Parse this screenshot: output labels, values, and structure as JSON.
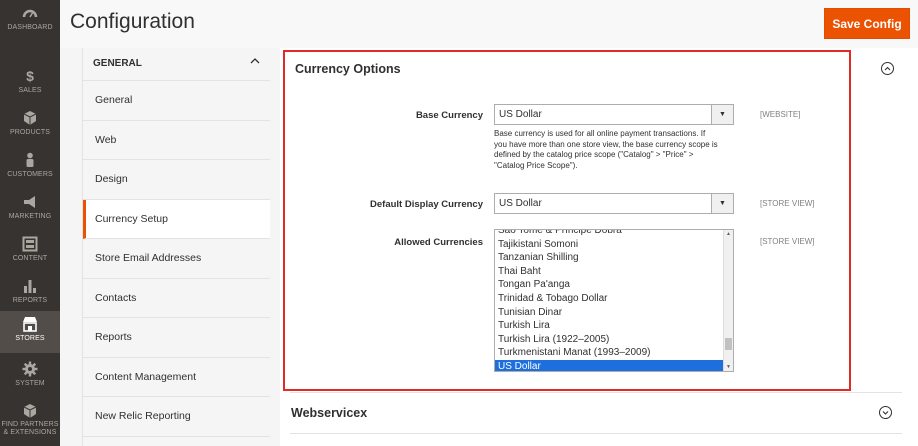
{
  "nav": [
    {
      "label": "DASHBOARD",
      "icon": "dashboard-icon"
    },
    {
      "label": "SALES",
      "icon": "dollar-icon"
    },
    {
      "label": "PRODUCTS",
      "icon": "cube-icon"
    },
    {
      "label": "CUSTOMERS",
      "icon": "person-icon"
    },
    {
      "label": "MARKETING",
      "icon": "megaphone-icon"
    },
    {
      "label": "CONTENT",
      "icon": "layout-icon"
    },
    {
      "label": "REPORTS",
      "icon": "bar-chart-icon"
    },
    {
      "label": "STORES",
      "icon": "store-icon"
    },
    {
      "label": "SYSTEM",
      "icon": "gear-icon"
    },
    {
      "label": "FIND PARTNERS",
      "label2": "& EXTENSIONS",
      "icon": "box-icon"
    }
  ],
  "header": {
    "title": "Configuration",
    "save_label": "Save Config"
  },
  "tabs": {
    "group_title": "GENERAL",
    "items": [
      "General",
      "Web",
      "Design",
      "Currency Setup",
      "Store Email Addresses",
      "Contacts",
      "Reports",
      "Content Management",
      "New Relic Reporting"
    ]
  },
  "currency_options": {
    "title": "Currency Options",
    "base_currency": {
      "label": "Base Currency",
      "value": "US Dollar",
      "scope": "[WEBSITE]",
      "note_lines": [
        "Base currency is used for all online payment transactions. If",
        "you have more than one store view, the base currency scope is",
        "defined by the catalog price scope (\"Catalog\" > \"Price\" >",
        "\"Catalog Price Scope\")."
      ]
    },
    "display_currency": {
      "label": "Default Display Currency",
      "value": "US Dollar",
      "scope": "[STORE VIEW]"
    },
    "allowed_currencies": {
      "label": "Allowed Currencies",
      "scope": "[STORE VIEW]",
      "options": [
        "São Tomé & Príncipe Dobra",
        "Tajikistani Somoni",
        "Tanzanian Shilling",
        "Thai Baht",
        "Tongan Pa'anga",
        "Trinidad & Tobago Dollar",
        "Tunisian Dinar",
        "Turkish Lira",
        "Turkish Lira (1922–2005)",
        "Turkmenistani Manat (1993–2009)",
        "US Dollar"
      ],
      "selected": "US Dollar"
    }
  },
  "webservicex": {
    "title": "Webservicex"
  },
  "colors": {
    "accent": "#eb5202",
    "highlight": "#e02b27",
    "selection": "#1e6fde"
  }
}
